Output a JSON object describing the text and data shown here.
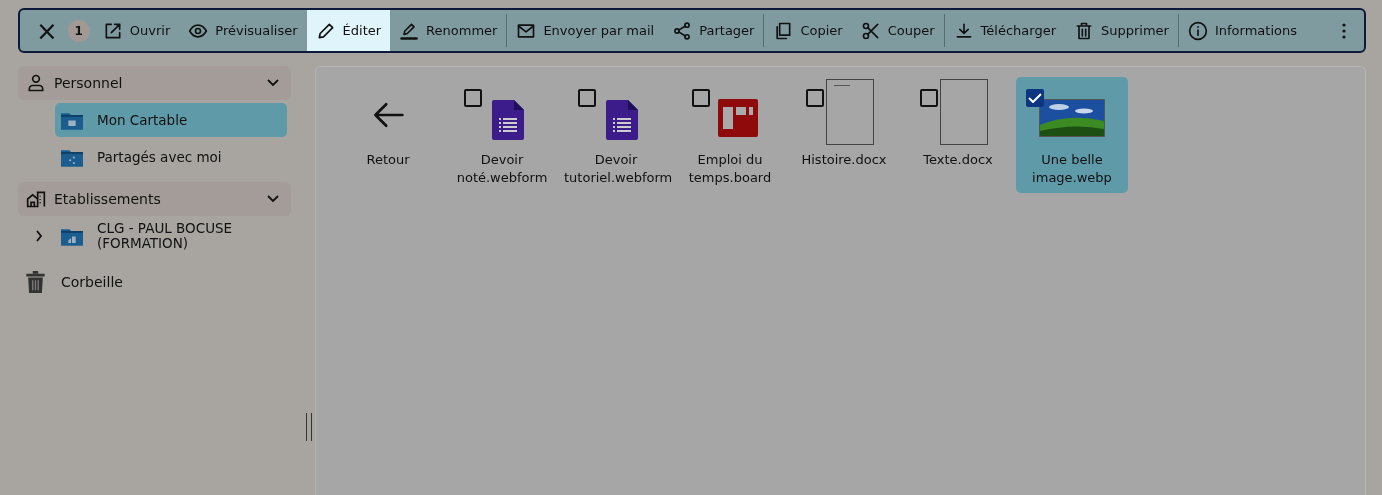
{
  "toolbar": {
    "close": "×",
    "count": "1",
    "groups": [
      [
        {
          "kind": "open",
          "label": "Ouvrir",
          "selected": false
        },
        {
          "kind": "preview",
          "label": "Prévisualiser",
          "selected": false
        },
        {
          "kind": "edit",
          "label": "Éditer",
          "selected": true
        },
        {
          "kind": "rename",
          "label": "Renommer",
          "selected": false
        }
      ],
      [
        {
          "kind": "mail",
          "label": "Envoyer par mail",
          "selected": false
        },
        {
          "kind": "share",
          "label": "Partager",
          "selected": false
        }
      ],
      [
        {
          "kind": "copy",
          "label": "Copier",
          "selected": false
        },
        {
          "kind": "cut",
          "label": "Couper",
          "selected": false
        }
      ],
      [
        {
          "kind": "download",
          "label": "Télécharger",
          "selected": false
        },
        {
          "kind": "delete",
          "label": "Supprimer",
          "selected": false
        }
      ],
      [
        {
          "kind": "info",
          "label": "Informations",
          "selected": false
        }
      ]
    ]
  },
  "sidebar": {
    "sections": [
      {
        "kind": "person",
        "label": "Personnel",
        "expanded": true,
        "children": [
          {
            "kind": "case",
            "label": "Mon Cartable",
            "selected": true
          },
          {
            "kind": "shared",
            "label": "Partagés avec moi",
            "selected": false
          }
        ]
      },
      {
        "kind": "building",
        "label": "Etablissements",
        "expanded": true,
        "children": [
          {
            "kind": "school",
            "label": "CLG - PAUL BOCUSE (FORMATION)",
            "selected": false,
            "expanded": false
          }
        ]
      }
    ],
    "trash": {
      "label": "Corbeille"
    }
  },
  "files": [
    {
      "kind": "back",
      "label": "Retour"
    },
    {
      "kind": "form",
      "label": "Devoir noté.webform",
      "checked": false
    },
    {
      "kind": "form",
      "label": "Devoir tutoriel.webform",
      "checked": false
    },
    {
      "kind": "board",
      "label": "Emploi du temps.board",
      "checked": false
    },
    {
      "kind": "doc-lined",
      "label": "Histoire.docx",
      "checked": false
    },
    {
      "kind": "doc",
      "label": "Texte.docx",
      "checked": false
    },
    {
      "label": "Une belle image.webp",
      "checked": true
    }
  ]
}
